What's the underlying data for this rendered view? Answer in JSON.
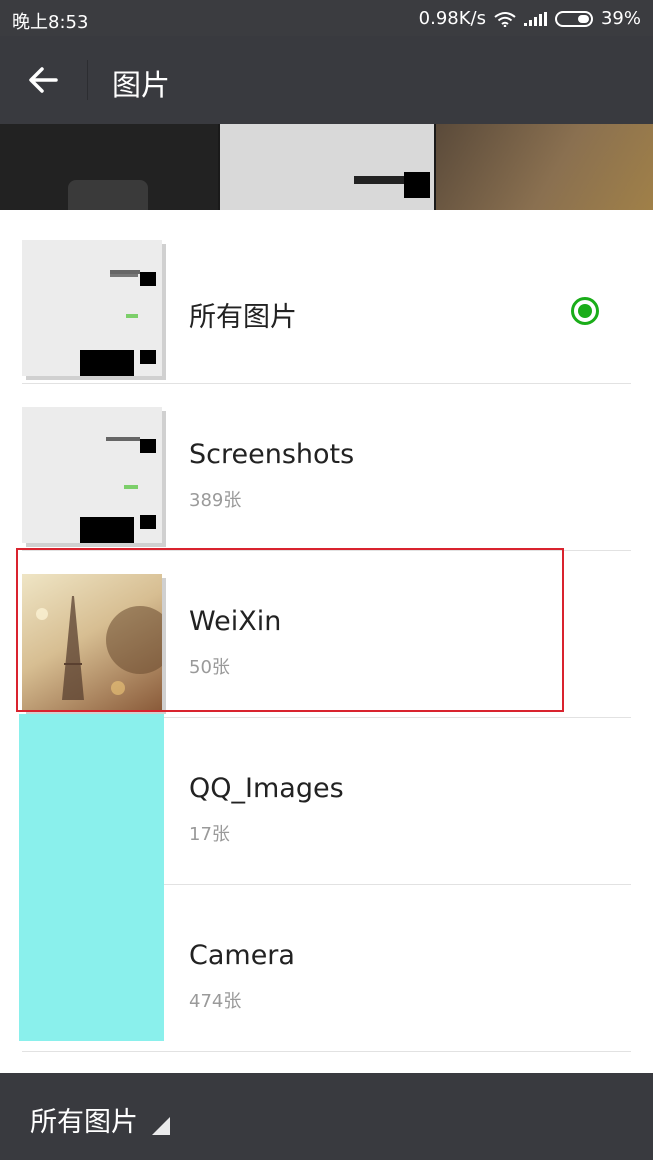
{
  "status_bar": {
    "time": "晚上8:53",
    "net_speed": "0.98K/s",
    "battery_percent": "39%"
  },
  "header": {
    "title": "图片"
  },
  "albums": [
    {
      "name": "所有图片",
      "count": "",
      "selected": true
    },
    {
      "name": "Screenshots",
      "count": "389张",
      "selected": false
    },
    {
      "name": "WeiXin",
      "count": "50张",
      "selected": false
    },
    {
      "name": "QQ_Images",
      "count": "17张",
      "selected": false
    },
    {
      "name": "Camera",
      "count": "474张",
      "selected": false
    }
  ],
  "footer": {
    "album_selector": "所有图片"
  },
  "colors": {
    "bar_bg": "#393a3f",
    "accent_green": "#1aad19",
    "highlight_red": "#d9232e",
    "cyan_block": "#8af0ec"
  },
  "icons": [
    "back-arrow-icon",
    "wifi-icon",
    "signal-icon",
    "battery-icon",
    "radio-checked-icon",
    "caret-icon",
    "camera-icon"
  ]
}
